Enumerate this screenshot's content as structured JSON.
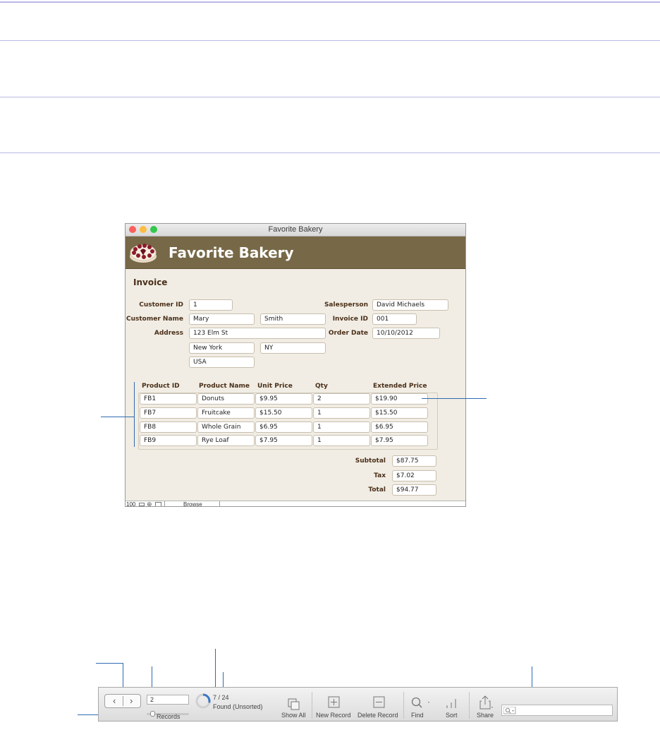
{
  "window": {
    "title": "Favorite Bakery",
    "banner_title": "Favorite Bakery",
    "section_title": "Invoice",
    "labels": {
      "customer_id": "Customer ID",
      "customer_name": "Customer Name",
      "address": "Address",
      "salesperson": "Salesperson",
      "invoice_id": "Invoice ID",
      "order_date": "Order Date"
    },
    "fields": {
      "customer_id": "1",
      "first_name": "Mary",
      "last_name": "Smith",
      "street": "123 Elm St",
      "city": "New York",
      "state": "NY",
      "country": "USA",
      "salesperson": "David Michaels",
      "invoice_id": "001",
      "order_date": "10/10/2012"
    },
    "line_items": {
      "headers": [
        "Product ID",
        "Product Name",
        "Unit Price",
        "Qty",
        "Extended Price"
      ],
      "rows": [
        [
          "FB1",
          "Donuts",
          "$9.95",
          "2",
          "$19.90"
        ],
        [
          "FB7",
          "Fruitcake",
          "$15.50",
          "1",
          "$15.50"
        ],
        [
          "FB8",
          "Whole Grain",
          "$6.95",
          "1",
          "$6.95"
        ],
        [
          "FB9",
          "Rye Loaf",
          "$7.95",
          "1",
          "$7.95"
        ]
      ]
    },
    "totals": {
      "subtotal_label": "Subtotal",
      "subtotal": "$87.75",
      "tax_label": "Tax",
      "tax": "$7.02",
      "total_label": "Total",
      "total": "$94.77"
    },
    "status_bar": {
      "zoom": "100",
      "mode": "Browse"
    }
  },
  "toolbar": {
    "record_number": "2",
    "records_label": "Records",
    "found_count": "7 / 24",
    "found_status": "Found (Unsorted)",
    "show_all": "Show All",
    "new_record": "New Record",
    "delete_record": "Delete Record",
    "find": "Find",
    "sort": "Sort",
    "share": "Share",
    "slider_fraction": 0.1,
    "found_fraction": 0.29
  },
  "colors": {
    "banner": "#776847",
    "layout_background": "#f1ede4",
    "label_text": "#4a2f19",
    "callout_line": "#2f6bb0",
    "rule": "#b8b8e6"
  }
}
